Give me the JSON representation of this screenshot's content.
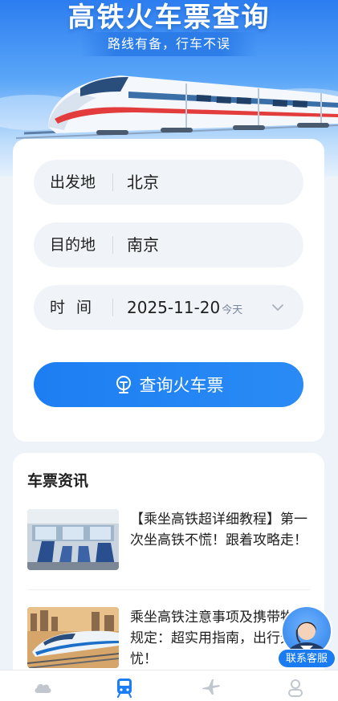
{
  "hero": {
    "title": "高铁火车票查询",
    "subtitle": "路线有备，行车不误"
  },
  "query": {
    "departure": {
      "label": "出发地",
      "value": "北京"
    },
    "destination": {
      "label": "目的地",
      "value": "南京"
    },
    "date": {
      "label": "时间",
      "value": "2025-11-20",
      "hint": "今天"
    },
    "submit_label": "查询火车票"
  },
  "news": {
    "title": "车票资讯",
    "items": [
      {
        "text": "【乘坐高铁超详细教程】第一次坐高铁不慌！跟着攻略走！"
      },
      {
        "text": "乘坐高铁注意事项及携带物品规定：超实用指南，出行无忧！"
      }
    ]
  },
  "customer_service": {
    "label": "联系客服"
  },
  "bottom_nav": {
    "items": [
      {
        "icon": "weather-icon",
        "active": false
      },
      {
        "icon": "train-icon",
        "active": true
      },
      {
        "icon": "airplane-icon",
        "active": false
      },
      {
        "icon": "profile-icon",
        "active": false
      }
    ]
  },
  "colors": {
    "primary": "#1c7ef2",
    "nav_inactive": "#c2c7cf"
  }
}
